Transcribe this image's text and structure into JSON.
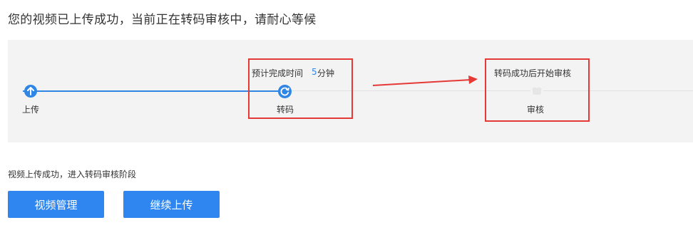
{
  "headline": "您的视频已上传成功，当前正在转码审核中，请耐心等候",
  "steps": [
    {
      "label": "上传",
      "icon": "arrow-up-icon",
      "state": "done"
    },
    {
      "label": "转码",
      "icon": "refresh-icon",
      "state": "active"
    },
    {
      "label": "审核",
      "icon": "review-icon",
      "state": "pending"
    }
  ],
  "eta": {
    "prefix": "预计完成时间",
    "value": "5",
    "unit": "分钟"
  },
  "review_note": "转码成功后开始审核",
  "status_text": "视频上传成功，进入转码审核阶段",
  "buttons": {
    "manage": "视频管理",
    "continue": "继续上传"
  },
  "colors": {
    "primary": "#2f86f0",
    "highlight": "#e53935",
    "panel": "#f3f3f3",
    "text": "#333333"
  }
}
